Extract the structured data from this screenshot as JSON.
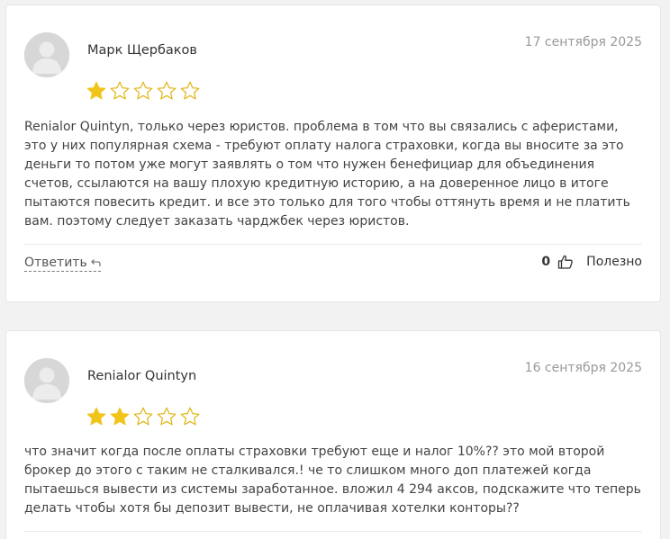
{
  "reviews": [
    {
      "author": "Марк Щербаков",
      "date": "17 сентября 2025",
      "rating": 1,
      "max_rating": 5,
      "text": "Renialor Quintyn, только через юристов. проблема в том что вы связались с аферистами, это у них популярная схема - требуют оплату налога страховки, когда вы вносите за это деньги то потом уже могут заявлять о том что нужен бенефициар для объединения счетов, ссылаются на вашу плохую кредитную историю, а на доверенное лицо в итоге пытаются повесить кредит. и все это только для того чтобы оттянуть время и не платить вам. поэтому следует заказать чарджбек через юристов.",
      "reply_label": "Ответить",
      "likes": "0",
      "helpful_label": "Полезно"
    },
    {
      "author": "Renialor Quintyn",
      "date": "16 сентября 2025",
      "rating": 2,
      "max_rating": 5,
      "text": "что значит когда после оплаты страховки требуют еще и налог 10%?? это мой второй брокер до этого с таким не сталкивался.! че то слишком много доп платежей когда пытаешься вывести из системы заработанное. вложил 4 294 аксов, подскажите что теперь делать чтобы хотя бы депозит вывести, не оплачивая хотелки конторы??"
    }
  ],
  "colors": {
    "star_filled": "#f0c419",
    "star_empty_stroke": "#e0b514",
    "avatar_bg": "#d7d7d7"
  },
  "icons": {
    "avatar": "user-avatar-icon",
    "star": "star-icon",
    "reply": "reply-arrow-icon",
    "like": "thumbs-up-icon"
  }
}
